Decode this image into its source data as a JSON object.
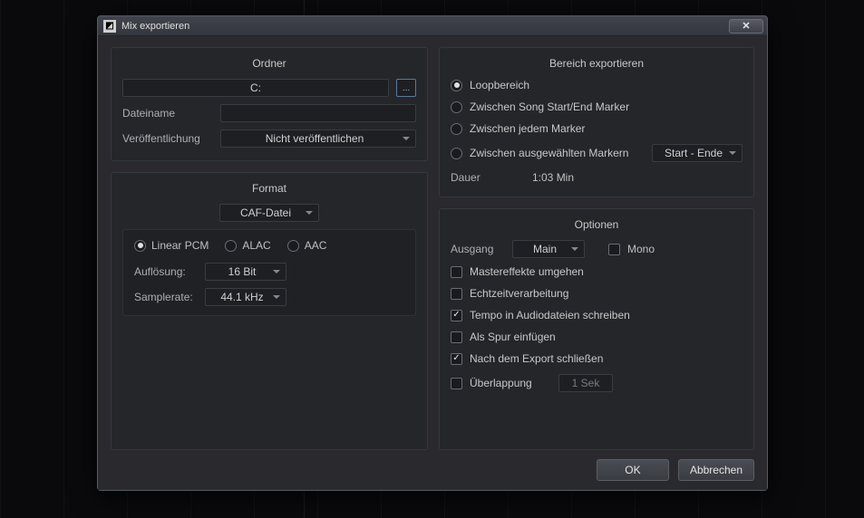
{
  "window": {
    "title": "Mix exportieren",
    "close": "✕"
  },
  "folder": {
    "title": "Ordner",
    "path": "C:",
    "browse": "...",
    "filename_label": "Dateiname",
    "filename_value": "",
    "publish_label": "Veröffentlichung",
    "publish_value": "Nicht veröffentlichen"
  },
  "format": {
    "title": "Format",
    "filetype": "CAF-Datei",
    "codec": {
      "options": [
        "Linear PCM",
        "ALAC",
        "AAC"
      ],
      "selected": "Linear PCM"
    },
    "resolution_label": "Auflösung:",
    "resolution_value": "16 Bit",
    "samplerate_label": "Samplerate:",
    "samplerate_value": "44.1 kHz"
  },
  "range": {
    "title": "Bereich exportieren",
    "options": {
      "loop": "Loopbereich",
      "song_markers": "Zwischen Song Start/End Marker",
      "each_marker": "Zwischen jedem Marker",
      "selected_markers": "Zwischen ausgewählten Markern"
    },
    "selected": "loop",
    "marker_range": "Start - Ende",
    "duration_label": "Dauer",
    "duration_value": "1:03 Min"
  },
  "options": {
    "title": "Optionen",
    "output_label": "Ausgang",
    "output_value": "Main",
    "mono_label": "Mono",
    "mono": false,
    "bypass_master_label": "Mastereffekte umgehen",
    "bypass_master": false,
    "realtime_label": "Echtzeitverarbeitung",
    "realtime": false,
    "write_tempo_label": "Tempo in Audiodateien schreiben",
    "write_tempo": true,
    "insert_track_label": "Als Spur einfügen",
    "insert_track": false,
    "close_after_label": "Nach dem Export schließen",
    "close_after": true,
    "overlap_label": "Überlappung",
    "overlap": false,
    "overlap_value": "1 Sek"
  },
  "footer": {
    "ok": "OK",
    "cancel": "Abbrechen"
  }
}
